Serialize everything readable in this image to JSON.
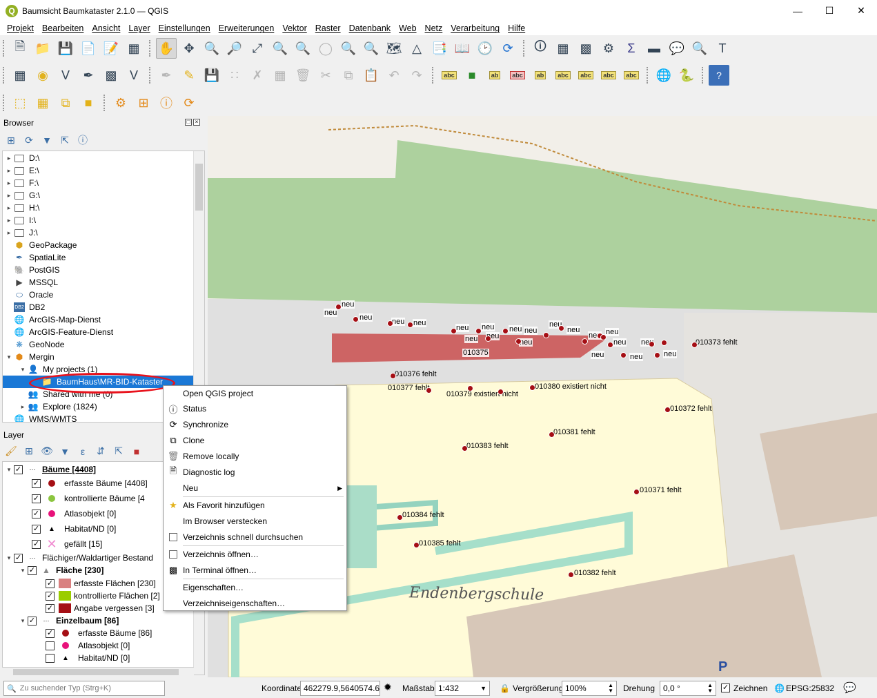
{
  "window": {
    "title": "Baumsicht Baumkataster 2.1.0 — QGIS",
    "app_icon": "Q"
  },
  "menu": [
    "Projekt",
    "Bearbeiten",
    "Ansicht",
    "Layer",
    "Einstellungen",
    "Erweiterungen",
    "Vektor",
    "Raster",
    "Datenbank",
    "Web",
    "Netz",
    "Verarbeitung",
    "Hilfe"
  ],
  "browser": {
    "title": "Browser",
    "items": [
      {
        "label": "D:\\",
        "icon": "folder-icon"
      },
      {
        "label": "E:\\",
        "icon": "folder-icon"
      },
      {
        "label": "F:\\",
        "icon": "folder-icon"
      },
      {
        "label": "G:\\",
        "icon": "folder-icon"
      },
      {
        "label": "H:\\",
        "icon": "folder-icon"
      },
      {
        "label": "I:\\",
        "icon": "folder-icon"
      },
      {
        "label": "J:\\",
        "icon": "folder-icon"
      },
      {
        "label": "GeoPackage",
        "icon": "geopackage-icon"
      },
      {
        "label": "SpatiaLite",
        "icon": "spatialite-icon"
      },
      {
        "label": "PostGIS",
        "icon": "postgis-icon"
      },
      {
        "label": "MSSQL",
        "icon": "mssql-icon"
      },
      {
        "label": "Oracle",
        "icon": "oracle-icon"
      },
      {
        "label": "DB2",
        "icon": "db2-icon"
      },
      {
        "label": "ArcGIS-Map-Dienst",
        "icon": "globe-icon"
      },
      {
        "label": "ArcGIS-Feature-Dienst",
        "icon": "globe-icon"
      },
      {
        "label": "GeoNode",
        "icon": "geonode-icon"
      },
      {
        "label": "Mergin",
        "icon": "mergin-icon"
      },
      {
        "label": "My projects (1)",
        "icon": "user-icon"
      },
      {
        "label": "BaumHaus\\MR-BID-Kataster",
        "icon": "project-icon"
      },
      {
        "label": "Shared with me (0)",
        "icon": "users-icon"
      },
      {
        "label": "Explore (1824)",
        "icon": "explore-icon"
      },
      {
        "label": "WMS/WMTS",
        "icon": "globe-icon"
      }
    ]
  },
  "layers": {
    "title": "Layer",
    "items": [
      {
        "label": "Bäume [4408]",
        "color": ""
      },
      {
        "label": "erfasste Bäume [4408]",
        "color": "#a50f15"
      },
      {
        "label": "kontrollierte Bäume [4",
        "color": "#8bc53f"
      },
      {
        "label": "Atlasobjekt [0]",
        "color": "#e8127a"
      },
      {
        "label": "Habitat/ND [0]",
        "color": "#000000"
      },
      {
        "label": "gefällt [15]",
        "color": "#f08ad0"
      },
      {
        "label": "Flächiger/Waldartiger Bestand",
        "color": ""
      },
      {
        "label": "Fläche [230]",
        "color": ""
      },
      {
        "label": "erfasste Flächen [230]",
        "color": "#d98080"
      },
      {
        "label": "kontrollierte Flächen [2]",
        "color": "#9acd00"
      },
      {
        "label": "Angabe vergessen [3]",
        "color": "#a50f15"
      },
      {
        "label": "Einzelbaum [86]",
        "color": ""
      },
      {
        "label": "erfasste Bäume [86]",
        "color": "#a50f15"
      },
      {
        "label": "Atlasobjekt [0]",
        "color": "#e8127a"
      },
      {
        "label": "Habitat/ND [0]",
        "color": "#000000"
      }
    ]
  },
  "context_menu": {
    "items": [
      {
        "label": "Open QGIS project",
        "icon": ""
      },
      {
        "label": "Status",
        "icon": "info-icon"
      },
      {
        "label": "Synchronize",
        "icon": "sync-icon"
      },
      {
        "label": "Clone",
        "icon": "clone-icon"
      },
      {
        "label": "Remove locally",
        "icon": "trash-icon"
      },
      {
        "label": "Diagnostic log",
        "icon": "log-icon"
      },
      {
        "label": "Neu",
        "icon": ""
      },
      {
        "label": "Als Favorit hinzufügen",
        "icon": "star-icon"
      },
      {
        "label": "Im Browser verstecken",
        "icon": ""
      },
      {
        "label": "Verzeichnis schnell durchsuchen",
        "icon": "checkbox-icon"
      },
      {
        "label": "Verzeichnis öffnen…",
        "icon": "folder-icon"
      },
      {
        "label": "In Terminal öffnen…",
        "icon": "terminal-icon"
      },
      {
        "label": "Eigenschaften…",
        "icon": ""
      },
      {
        "label": "Verzeichniseigenschaften…",
        "icon": ""
      }
    ]
  },
  "map": {
    "labels": [
      "neu",
      "neu",
      "neu",
      "neu",
      "neu",
      "neu",
      "neu",
      "neu",
      "neu",
      "neu",
      "neu",
      "neu",
      "neu",
      "neu",
      "neu",
      "neu",
      "neu",
      "neu",
      "neu",
      "neu",
      "010375",
      "010373  fehlt",
      "010376  fehlt",
      "010377  fehlt",
      "010379  existiert nicht",
      "010380  existiert nicht",
      "010372  fehlt",
      "010381  fehlt",
      "010383  fehlt",
      "010371  fehlt",
      "010384  fehlt",
      "010385  fehlt",
      "010382  fehlt"
    ],
    "place_name": "Endenbergschule",
    "parking": "P"
  },
  "status": {
    "search_placeholder": "Zu suchender Typ (Strg+K)",
    "coord_label": "Koordinate",
    "coord_value": "462279.9,5640574.6",
    "scale_label": "Maßstab",
    "scale_value": "1:432",
    "magnifier_label": "Vergrößerung",
    "magnifier_value": "100%",
    "rotation_label": "Drehung",
    "rotation_value": "0,0 °",
    "render_label": "Zeichnen",
    "crs": "EPSG:25832"
  }
}
